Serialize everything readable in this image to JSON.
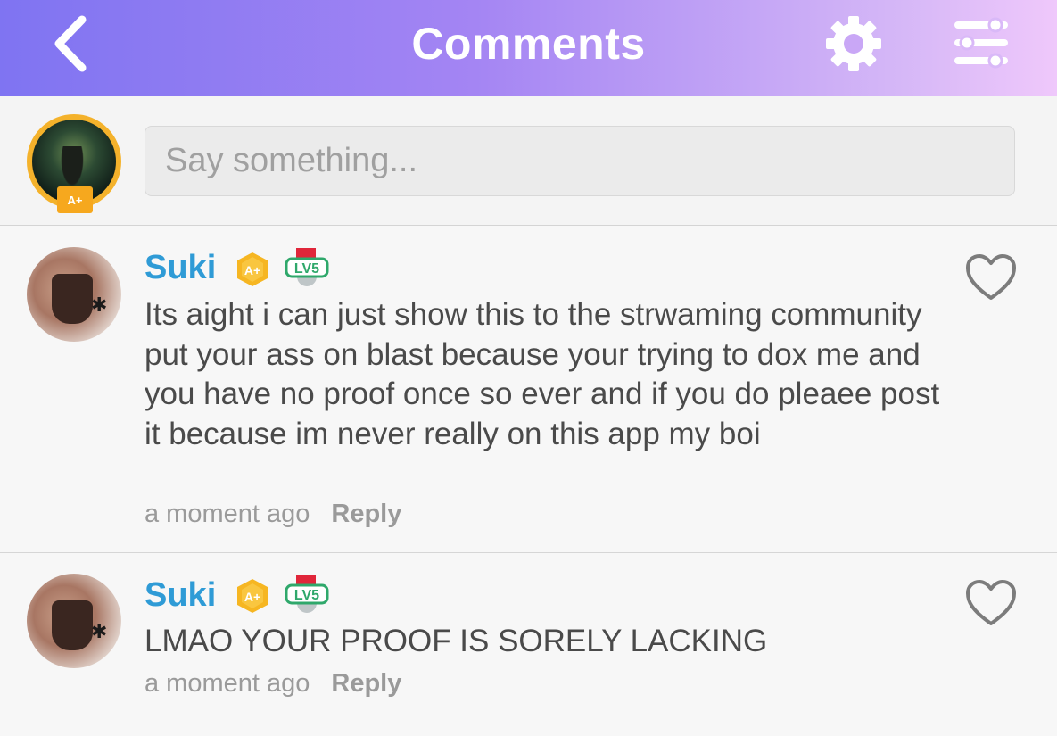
{
  "header": {
    "title": "Comments",
    "gradient_start": "#7f74f2",
    "gradient_end": "#efc8fb"
  },
  "composer": {
    "placeholder": "Say something...",
    "avatar_badge": "A+"
  },
  "comments": [
    {
      "author": "Suki",
      "role_badge": "A+",
      "level_badge": "LV5",
      "text": "Its aight i can just show this to the strwaming community put your ass on blast because your trying to dox me and you have no proof once so ever and if you do pleaee post it because im never really on this app my boi",
      "time": "a moment ago",
      "reply_label": "Reply"
    },
    {
      "author": "Suki",
      "role_badge": "A+",
      "level_badge": "LV5",
      "text": "LMAO YOUR PROOF IS SORELY LACKING",
      "time": "a moment ago",
      "reply_label": "Reply"
    }
  ],
  "colors": {
    "username": "#2f9bd6",
    "badge_gold": "#f6a81e",
    "level_green": "#2fa86b"
  },
  "icons": {
    "back": "chevron-left-icon",
    "settings": "gear-icon",
    "filter": "sliders-icon",
    "like": "heart-outline-icon"
  }
}
